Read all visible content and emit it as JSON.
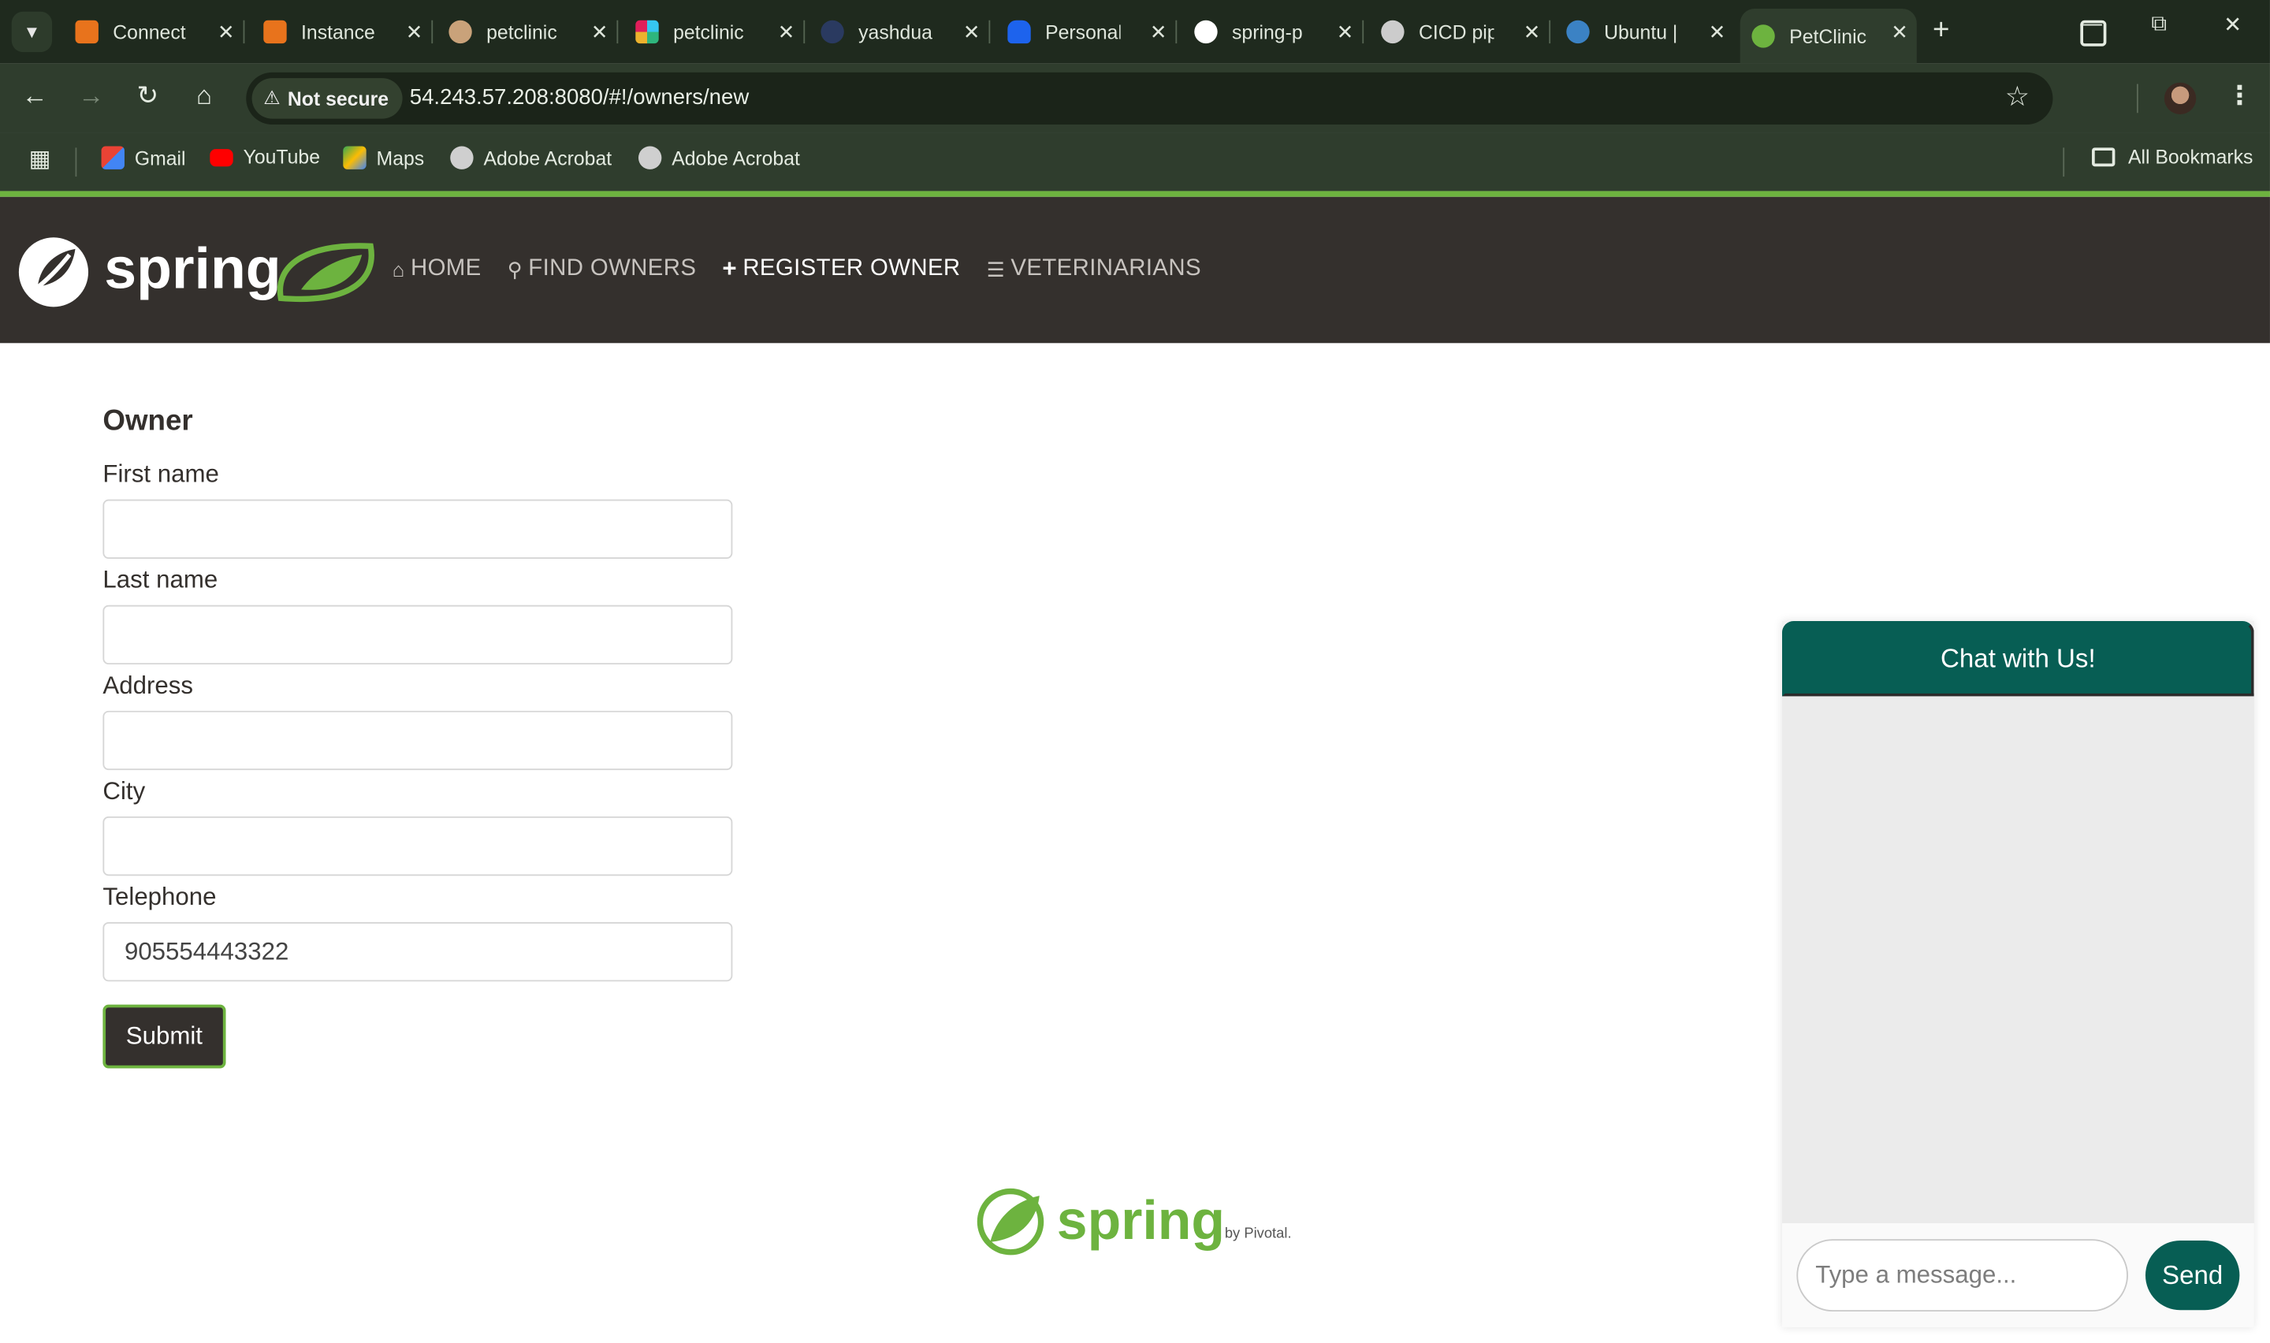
{
  "browser": {
    "tabs": [
      {
        "title": "Connect",
        "favicon_color": "#e8731c"
      },
      {
        "title": "Instance",
        "favicon_color": "#e8731c"
      },
      {
        "title": "petclinic",
        "favicon_color": "#c9a27a"
      },
      {
        "title": "petclinic",
        "favicon_color": "#4a154b"
      },
      {
        "title": "yashdua",
        "favicon_color": "#2a3a60"
      },
      {
        "title": "Personal",
        "favicon_color": "#1d63ed"
      },
      {
        "title": "spring-p",
        "favicon_color": "#ffffff"
      },
      {
        "title": "CICD pip",
        "favicon_color": "#cccccc"
      },
      {
        "title": "Ubuntu |",
        "favicon_color": "#3b82c4"
      },
      {
        "title": "PetClinic",
        "favicon_color": "#6db33f"
      }
    ],
    "security_label": "Not secure",
    "url": "54.243.57.208:8080/#!/owners/new",
    "bookmarks": [
      "Gmail",
      "YouTube",
      "Maps",
      "Adobe Acrobat",
      "Adobe Acrobat"
    ],
    "all_bookmarks": "All Bookmarks"
  },
  "nav": {
    "brand": "spring",
    "links": [
      {
        "icon": "home-icon",
        "label": "HOME"
      },
      {
        "icon": "search-icon",
        "label": "FIND OWNERS"
      },
      {
        "icon": "plus-icon",
        "label": "REGISTER OWNER"
      },
      {
        "icon": "list-icon",
        "label": "VETERINARIANS"
      }
    ]
  },
  "form": {
    "heading": "Owner",
    "fields": [
      {
        "label": "First name",
        "value": ""
      },
      {
        "label": "Last name",
        "value": ""
      },
      {
        "label": "Address",
        "value": ""
      },
      {
        "label": "City",
        "value": ""
      },
      {
        "label": "Telephone",
        "value": "905554443322"
      }
    ],
    "submit": "Submit"
  },
  "footer": {
    "brand": "spring",
    "byline": "by Pivotal."
  },
  "chat": {
    "title": "Chat with Us!",
    "placeholder": "Type a message...",
    "send": "Send"
  },
  "colors": {
    "spring_green": "#6db33f",
    "nav_dark": "#34302d",
    "chat_teal": "#075e54"
  }
}
